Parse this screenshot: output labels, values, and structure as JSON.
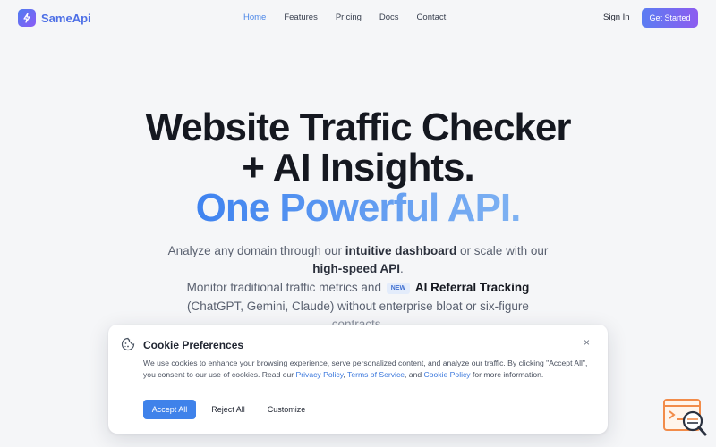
{
  "nav": {
    "brand": "SameApi",
    "links": [
      "Home",
      "Features",
      "Pricing",
      "Docs",
      "Contact"
    ],
    "signin": "Sign In",
    "cta": "Get Started"
  },
  "hero": {
    "line1": "Website Traffic Checker",
    "line2": "+ AI Insights.",
    "line3": "One Powerful API.",
    "sub1_pre": "Analyze any domain through our ",
    "sub1_bold": "intuitive dashboard",
    "sub1_post": " or scale with our",
    "sub2_bold": "high-speed API",
    "sub2_post": ".",
    "sub3_pre": "Monitor traditional traffic metrics and",
    "badge": "NEW",
    "sub3_bold": "AI Referral Tracking",
    "sub4": "(ChatGPT, Gemini, Claude) without enterprise bloat or six-figure",
    "sub5": "contracts."
  },
  "cookie": {
    "title": "Cookie Preferences",
    "close": "×",
    "text_pre": "We use cookies to enhance your browsing experience, serve personalized content, and analyze our traffic. By clicking \"Accept All\", you consent to our use of cookies. Read our ",
    "privacy": "Privacy Policy",
    "sep1": ", ",
    "terms": "Terms of Service",
    "sep2": ", and ",
    "cookie_policy": "Cookie Policy",
    "text_post": " for more information.",
    "accept": "Accept All",
    "reject": "Reject All",
    "customize": "Customize"
  },
  "colors": {
    "accent": "#4a86e8",
    "brand_gradient_start": "#5b7df2",
    "brand_gradient_end": "#8d5cf0",
    "widget_orange": "#f28c4a"
  }
}
